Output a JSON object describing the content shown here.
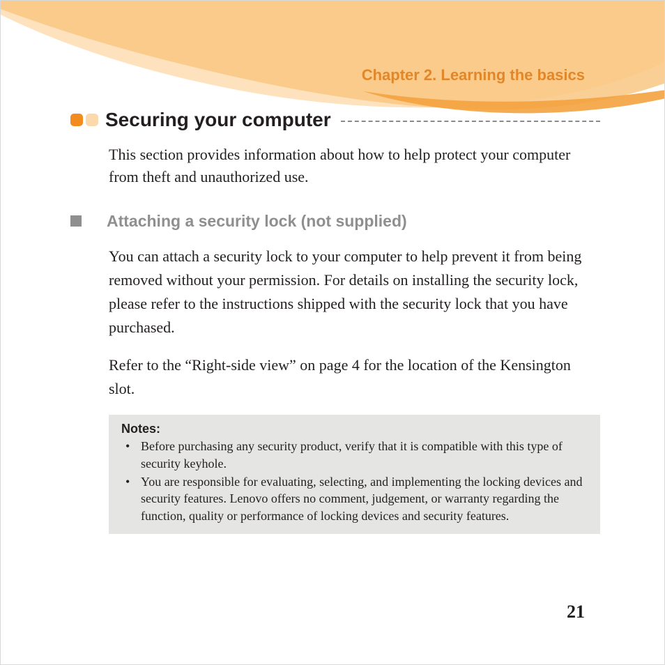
{
  "chapter_header": "Chapter 2. Learning the basics",
  "section": {
    "title": "Securing your computer",
    "intro": "This section provides information about how to help protect your computer from theft and unauthorized use."
  },
  "subsection": {
    "title": "Attaching a security lock (not supplied)",
    "para1": "You can attach a security lock to your computer to help prevent it from being removed without your permission. For details on installing the security lock, please refer to the instructions shipped with the security lock that you have purchased.",
    "para2": "Refer to the “Right-side view” on page 4 for the location of the Kensington slot."
  },
  "notes": {
    "title": "Notes:",
    "items": [
      "Before purchasing any security product, verify that it is compatible with this type of security keyhole.",
      "You are responsible for evaluating, selecting, and implementing the locking devices and security features. Lenovo offers no comment, judgement, or warranty regarding the function, quality or performance of locking devices and security features."
    ]
  },
  "page_number": "21"
}
